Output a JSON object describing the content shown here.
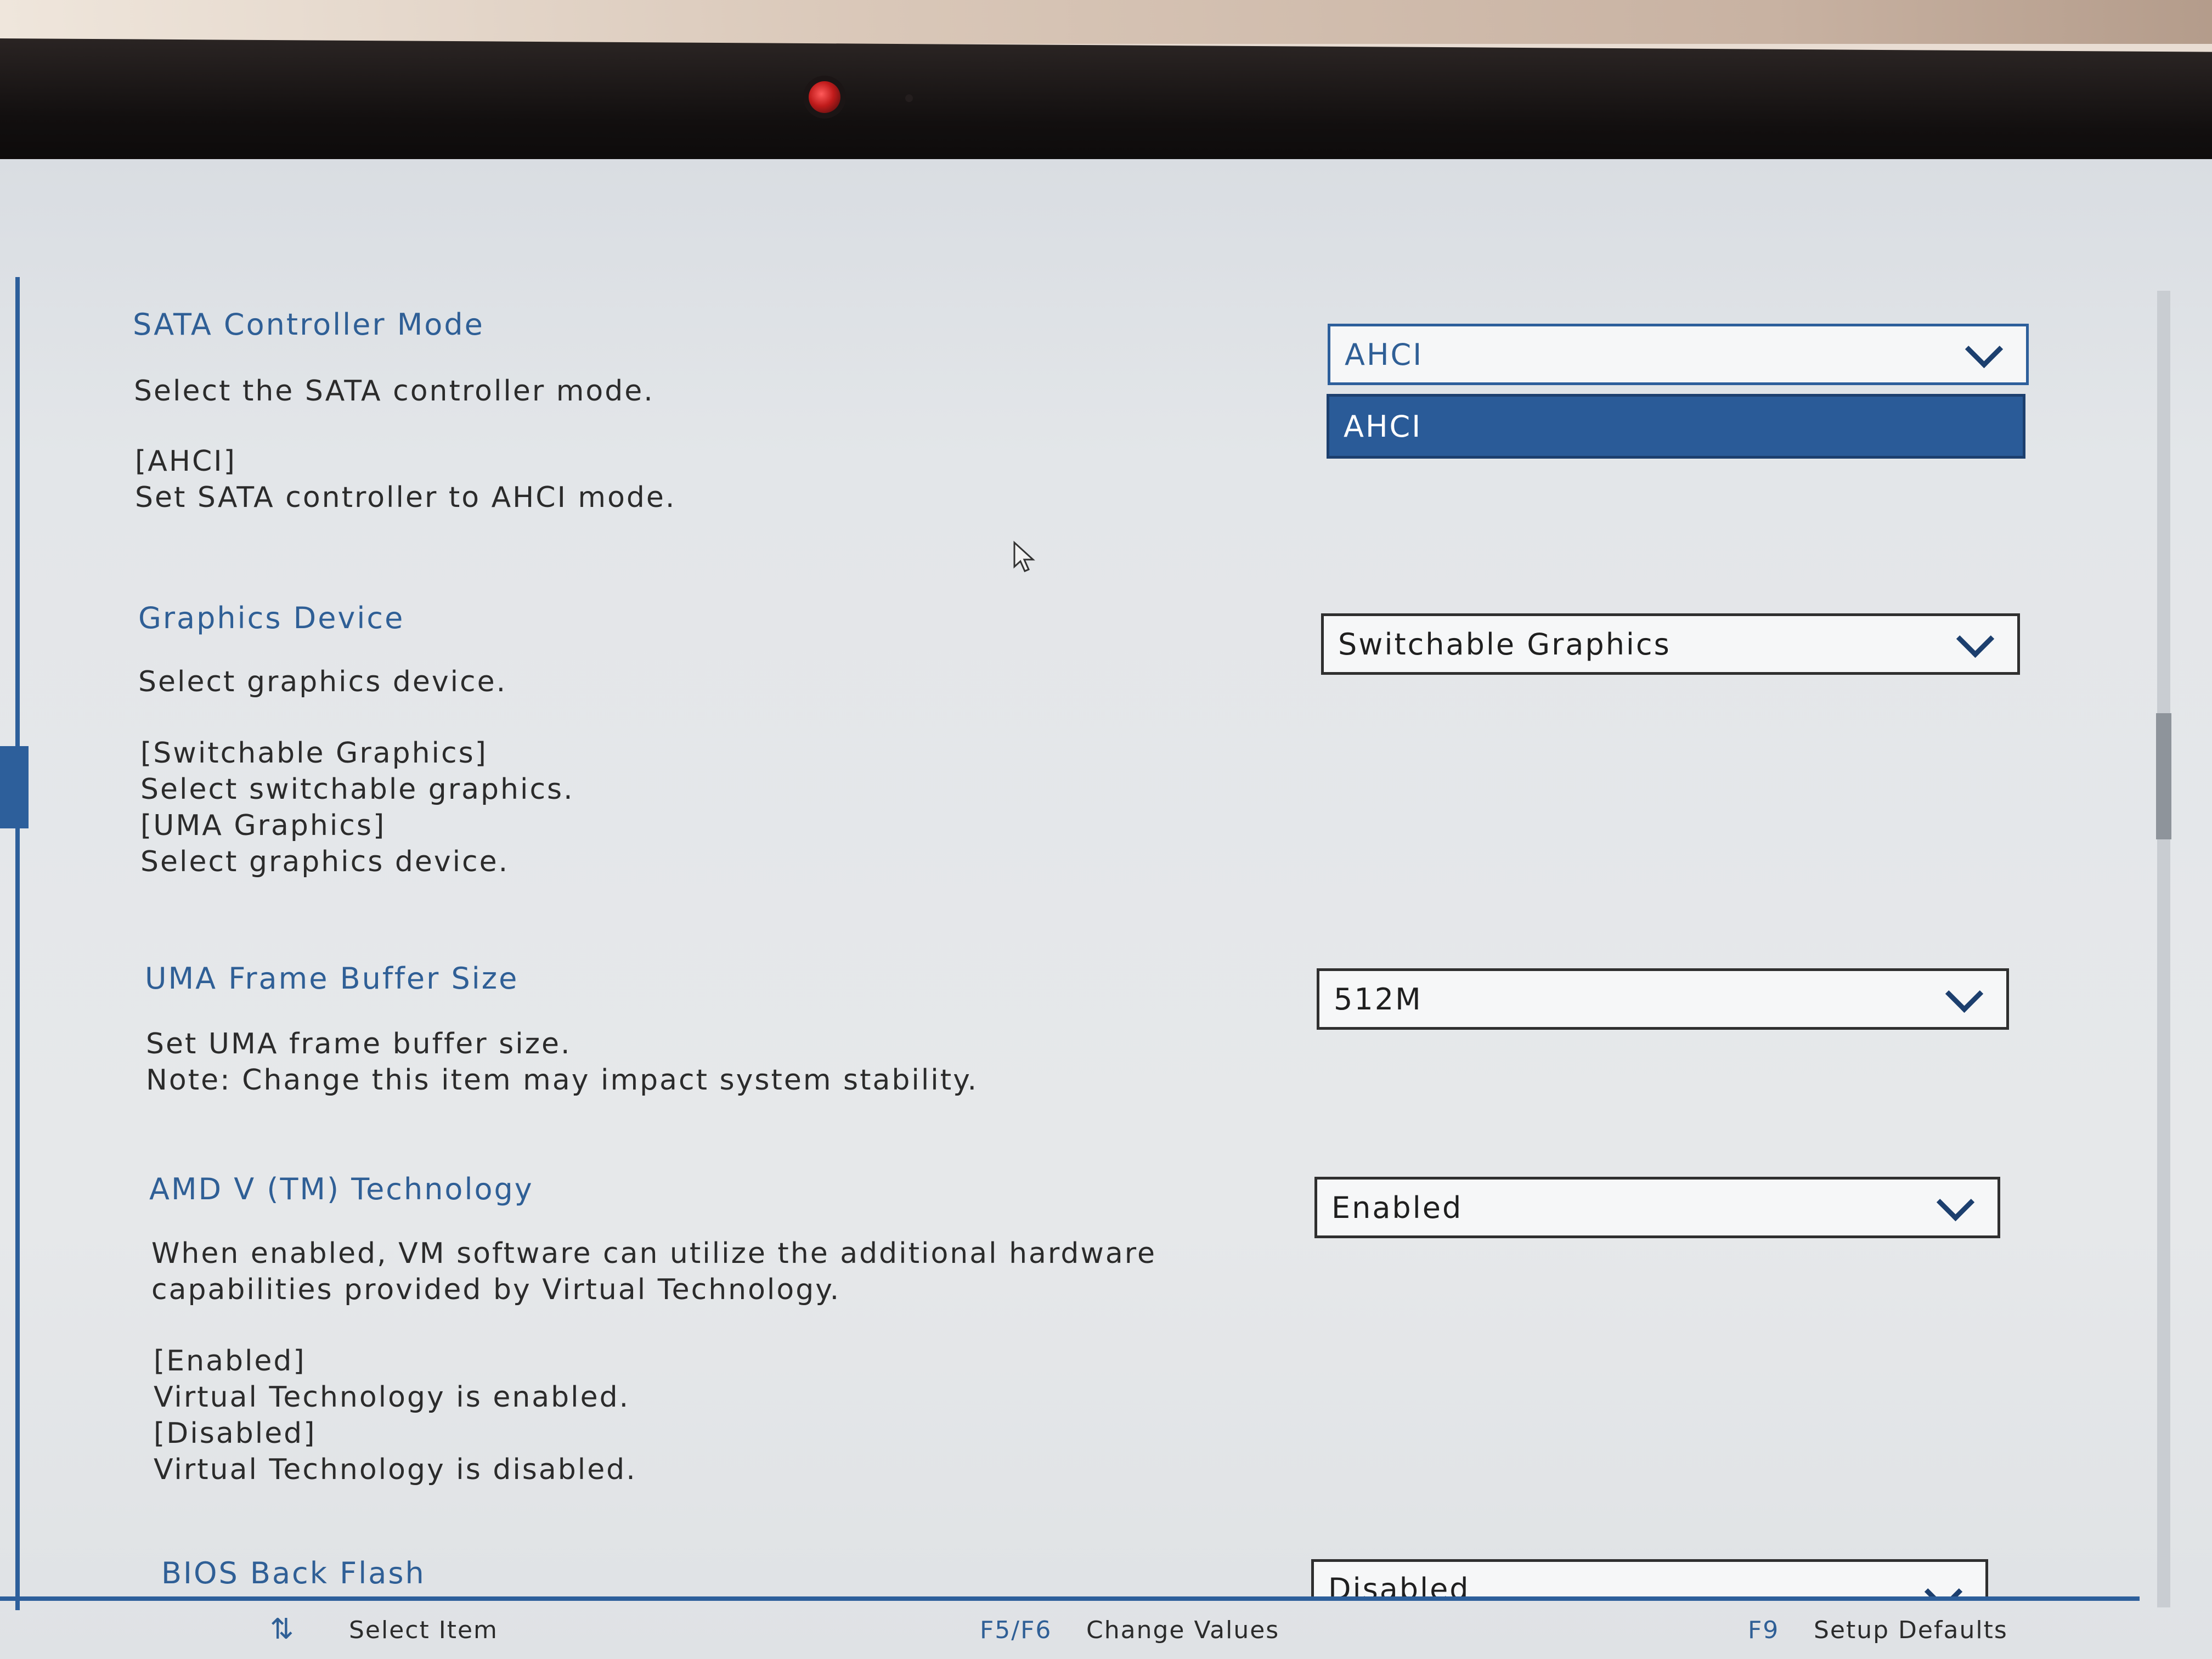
{
  "settings": [
    {
      "title": "SATA Controller Mode",
      "desc": [
        "Select the SATA controller mode."
      ],
      "options": [
        "[AHCI]",
        "Set SATA controller to AHCI mode."
      ],
      "value": "AHCI"
    },
    {
      "title": "Graphics Device",
      "desc": [
        "Select graphics device."
      ],
      "options": [
        "[Switchable Graphics]",
        "Select switchable graphics.",
        "[UMA Graphics]",
        "Select graphics device."
      ],
      "value": "Switchable Graphics"
    },
    {
      "title": "UMA Frame Buffer Size",
      "desc": [
        "Set UMA frame buffer size.",
        "Note: Change this item may impact system stability."
      ],
      "value": "512M"
    },
    {
      "title": "AMD V (TM) Technology",
      "desc": [
        "When enabled, VM software can utilize the additional hardware",
        "capabilities provided by Virtual Technology."
      ],
      "options": [
        "[Enabled]",
        "Virtual Technology is enabled.",
        "[Disabled]",
        "Virtual Technology is disabled."
      ],
      "value": "Enabled"
    },
    {
      "title": "BIOS Back Flash",
      "value": "Disabled"
    }
  ],
  "dropdown_open": {
    "option": "AHCI"
  },
  "footer": {
    "select_icon": "arrows-up-down-icon",
    "select_label": "Select Item",
    "change_key": "F5/F6",
    "change_label": "Change Values",
    "defaults_key": "F9",
    "defaults_label": "Setup Defaults"
  },
  "colors": {
    "accent": "#2d5f9b",
    "text": "#2b2b2b",
    "background": "#e6e8ea"
  }
}
